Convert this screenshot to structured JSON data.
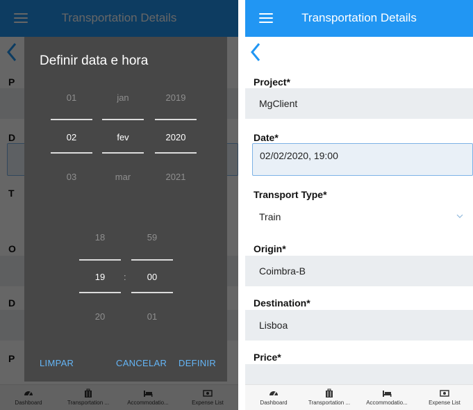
{
  "app": {
    "title": "Transportation Details"
  },
  "form": {
    "project": {
      "label": "Project*",
      "value": "MgClient"
    },
    "date": {
      "label": "Date*",
      "value": "02/02/2020, 19:00"
    },
    "transport_type": {
      "label": "Transport Type*",
      "value": "Train"
    },
    "origin": {
      "label": "Origin*",
      "value": "Coimbra-B"
    },
    "destination": {
      "label": "Destination*",
      "value": "Lisboa"
    },
    "price": {
      "label": "Price*",
      "value": ""
    }
  },
  "left_labels": {
    "project_initial": "P",
    "date_initial": "D",
    "type_initial": "T",
    "origin_initial": "O",
    "destination_initial": "D",
    "price_initial": "P"
  },
  "dialog": {
    "title": "Definir data e hora",
    "day": {
      "prev": "01",
      "selected": "02",
      "next": "03"
    },
    "month": {
      "prev": "jan",
      "selected": "fev",
      "next": "mar"
    },
    "year": {
      "prev": "2019",
      "selected": "2020",
      "next": "2021"
    },
    "hour": {
      "prev": "18",
      "selected": "19",
      "next": "20"
    },
    "minute": {
      "prev": "59",
      "selected": "00",
      "next": "01"
    },
    "separator": ":",
    "clear_label": "LIMPAR",
    "cancel_label": "CANCELAR",
    "set_label": "DEFINIR"
  },
  "nav": {
    "items": [
      {
        "label": "Dashboard",
        "icon": "dashboard-icon"
      },
      {
        "label": "Transportation ...",
        "icon": "luggage-icon"
      },
      {
        "label": "Accommodatio...",
        "icon": "bed-icon"
      },
      {
        "label": "Expense List",
        "icon": "money-icon"
      }
    ]
  },
  "colors": {
    "appbar": "#2196f3",
    "accent": "#64b5f6",
    "dialog_bg": "#474747",
    "field_bg": "#eaedf0"
  }
}
